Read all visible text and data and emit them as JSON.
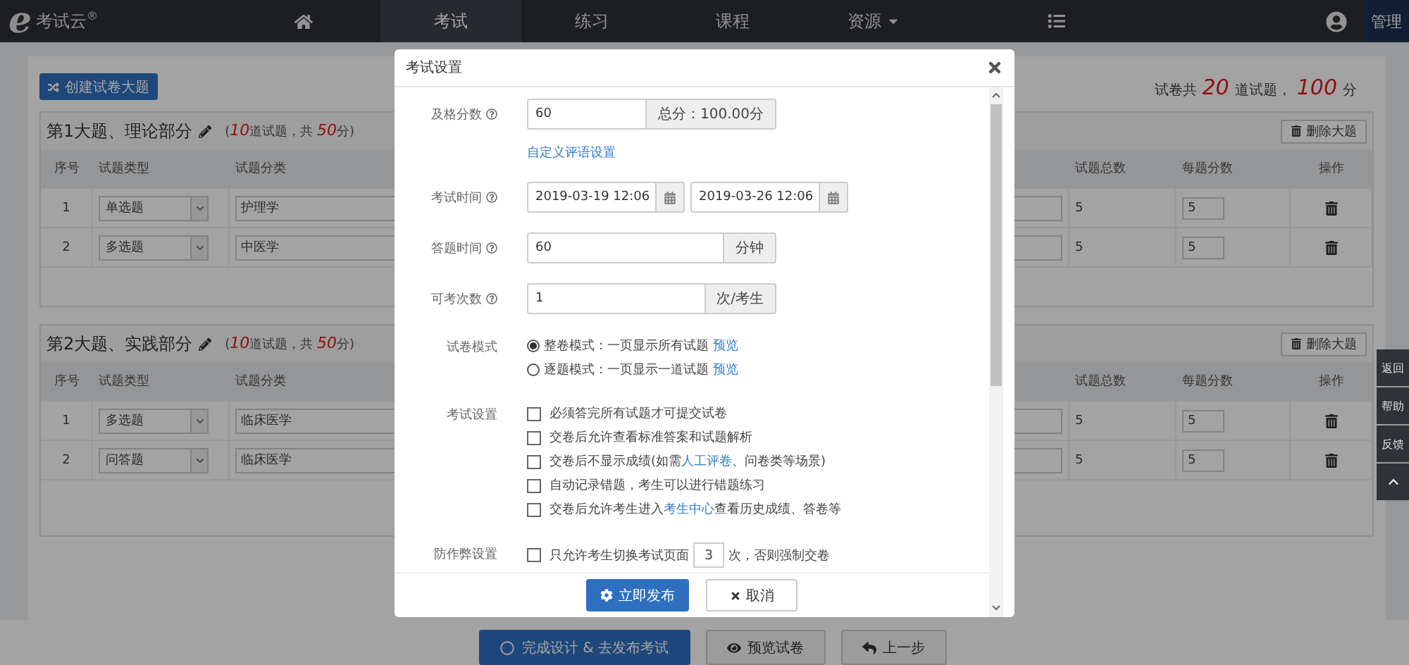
{
  "nav": {
    "logo_letter": "e",
    "logo_text": "考试云$^{®}$",
    "tabs": [
      {
        "label": "考试",
        "selected": true,
        "dropdown": false
      },
      {
        "label": "练习",
        "selected": false,
        "dropdown": false
      },
      {
        "label": "课程",
        "selected": false,
        "dropdown": false
      },
      {
        "label": "资源",
        "selected": false,
        "dropdown": true
      }
    ],
    "admin": "管理"
  },
  "toolbar": {
    "create_button": "创建试卷大题",
    "prefix": "试卷共",
    "questions": "20",
    "middle": "道试题，",
    "score": "100",
    "suffix": "分"
  },
  "sections": [
    {
      "title": "第1大题、理论部分",
      "open": "(",
      "count": "10",
      "mid": "道试题，共",
      "score": "50",
      "close": "分)",
      "delete_button": "删除大题",
      "columns": [
        "序号",
        "试题类型",
        "试题分类",
        "试题总数",
        "每题分数",
        "操作"
      ],
      "rows": [
        {
          "index": "1",
          "type": "单选题",
          "category": "护理学",
          "total": "5",
          "per_score": "5"
        },
        {
          "index": "2",
          "type": "多选题",
          "category": "中医学",
          "total": "5",
          "per_score": "5"
        }
      ]
    },
    {
      "title": "第2大题、实践部分",
      "open": "(",
      "count": "10",
      "mid": "道试题，共",
      "score": "50",
      "close": "分)",
      "delete_button": "删除大题",
      "columns": [
        "序号",
        "试题类型",
        "试题分类",
        "试题总数",
        "每题分数",
        "操作"
      ],
      "rows": [
        {
          "index": "1",
          "type": "多选题",
          "category": "临床医学",
          "total": "5",
          "per_score": "5"
        },
        {
          "index": "2",
          "type": "问答题",
          "category": "临床医学",
          "total": "5",
          "per_score": "5"
        }
      ]
    }
  ],
  "bottom_buttons": [
    {
      "label": "完成设计 & 去发布考试",
      "kind": "primary"
    },
    {
      "label": "预览试卷",
      "kind": "preview"
    },
    {
      "label": "上一步",
      "kind": "back"
    }
  ],
  "side_tools": [
    "返回",
    "帮助",
    "反馈"
  ],
  "modal": {
    "title": "考试设置",
    "fields": [
      {
        "kind": "input_addon",
        "label": "及格分数",
        "help": true,
        "value": "60",
        "addon": "总分：100.00分",
        "link": "自定义评语设置"
      },
      {
        "kind": "date_range",
        "label": "考试时间",
        "help": true,
        "start": "2019-03-19 12:06",
        "end": "2019-03-26 12:06"
      },
      {
        "kind": "input_addon",
        "label": "答题时间",
        "help": true,
        "value": "60",
        "addon": "分钟"
      },
      {
        "kind": "input_addon",
        "label": "可考次数",
        "help": true,
        "value": "1",
        "addon": "次/考生"
      },
      {
        "kind": "radio",
        "label": "试卷模式",
        "help": false,
        "options": [
          {
            "text": "整卷模式：一页显示所有试题",
            "link": "预览",
            "selected": true
          },
          {
            "text": "逐题模式：一页显示一道试题",
            "link": "预览",
            "selected": false
          }
        ]
      },
      {
        "kind": "checks",
        "label": "考试设置",
        "help": false,
        "options": [
          {
            "checked": false,
            "parts": [
              {
                "kind": "text",
                "text": "必须答完所有试题才可提交试卷"
              }
            ]
          },
          {
            "checked": false,
            "parts": [
              {
                "kind": "text",
                "text": "交卷后允许查看标准答案和试题解析"
              }
            ]
          },
          {
            "checked": false,
            "parts": [
              {
                "kind": "text",
                "text": "交卷后不显示成绩(如需"
              },
              {
                "kind": "link",
                "text": "人工评卷"
              },
              {
                "kind": "text",
                "text": "、问卷类等场景)"
              }
            ]
          },
          {
            "checked": false,
            "parts": [
              {
                "kind": "text",
                "text": "自动记录错题，考生可以进行错题练习"
              }
            ]
          },
          {
            "checked": false,
            "parts": [
              {
                "kind": "text",
                "text": "交卷后允许考生进入"
              },
              {
                "kind": "link",
                "text": "考生中心"
              },
              {
                "kind": "text",
                "text": "查看历史成绩、答卷等"
              }
            ]
          }
        ]
      },
      {
        "kind": "anti_cheat",
        "label": "防作弊设置",
        "help": false,
        "checked": false,
        "before": "只允许考生切换考试页面",
        "value": "3",
        "after": "次，否则强制交卷"
      }
    ],
    "publish": "立即发布",
    "cancel": "取消"
  }
}
